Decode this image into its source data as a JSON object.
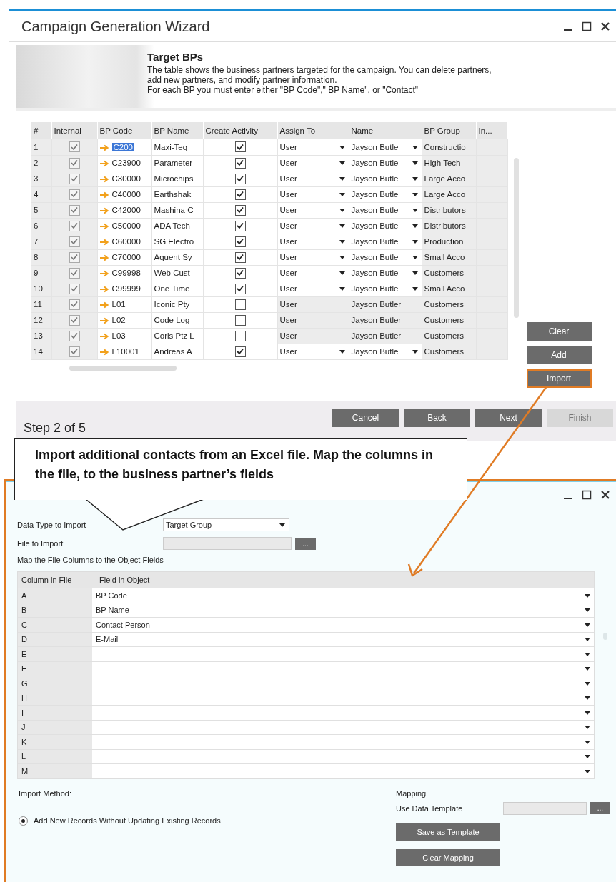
{
  "wizard": {
    "title": "Campaign Generation Wizard",
    "header": {
      "heading": "Target BPs",
      "lines": [
        "The table shows the business partners targeted for the campaign. You can delete partners,",
        "add new partners, and modify partner information.",
        "For each BP you must enter either \"BP Code\",\" BP Name\", or \"Contact\""
      ]
    },
    "table": {
      "columns": [
        "#",
        "Internal",
        "BP Code",
        "BP Name",
        "Create Activity",
        "Assign To",
        "Name",
        "BP Group",
        "In..."
      ],
      "rows": [
        {
          "num": "1",
          "internal": true,
          "bp_code": "C200",
          "code_selected": true,
          "bp_name": "Maxi-Teq",
          "create_activity": true,
          "assign_to": "User",
          "editable": true,
          "name": "Jayson Butle",
          "bp_group": "Constructio"
        },
        {
          "num": "2",
          "internal": true,
          "bp_code": "C23900",
          "code_selected": false,
          "bp_name": "Parameter",
          "create_activity": true,
          "assign_to": "User",
          "editable": true,
          "name": "Jayson Butle",
          "bp_group": "High Tech"
        },
        {
          "num": "3",
          "internal": true,
          "bp_code": "C30000",
          "code_selected": false,
          "bp_name": "Microchips",
          "create_activity": true,
          "assign_to": "User",
          "editable": true,
          "name": "Jayson Butle",
          "bp_group": "Large Acco"
        },
        {
          "num": "4",
          "internal": true,
          "bp_code": "C40000",
          "code_selected": false,
          "bp_name": "Earthshak",
          "create_activity": true,
          "assign_to": "User",
          "editable": true,
          "name": "Jayson Butle",
          "bp_group": "Large Acco"
        },
        {
          "num": "5",
          "internal": true,
          "bp_code": "C42000",
          "code_selected": false,
          "bp_name": "Mashina C",
          "create_activity": true,
          "assign_to": "User",
          "editable": true,
          "name": "Jayson Butle",
          "bp_group": "Distributors"
        },
        {
          "num": "6",
          "internal": true,
          "bp_code": "C50000",
          "code_selected": false,
          "bp_name": "ADA Tech",
          "create_activity": true,
          "assign_to": "User",
          "editable": true,
          "name": "Jayson Butle",
          "bp_group": "Distributors"
        },
        {
          "num": "7",
          "internal": true,
          "bp_code": "C60000",
          "code_selected": false,
          "bp_name": "SG Electro",
          "create_activity": true,
          "assign_to": "User",
          "editable": true,
          "name": "Jayson Butle",
          "bp_group": "Production"
        },
        {
          "num": "8",
          "internal": true,
          "bp_code": "C70000",
          "code_selected": false,
          "bp_name": "Aquent Sy",
          "create_activity": true,
          "assign_to": "User",
          "editable": true,
          "name": "Jayson Butle",
          "bp_group": "Small Acco"
        },
        {
          "num": "9",
          "internal": true,
          "bp_code": "C99998",
          "code_selected": false,
          "bp_name": "Web Cust",
          "create_activity": true,
          "assign_to": "User",
          "editable": true,
          "name": "Jayson Butle",
          "bp_group": "Customers"
        },
        {
          "num": "10",
          "internal": true,
          "bp_code": "C99999",
          "code_selected": false,
          "bp_name": "One Time",
          "create_activity": true,
          "assign_to": "User",
          "editable": true,
          "name": "Jayson Butle",
          "bp_group": "Small Acco"
        },
        {
          "num": "11",
          "internal": true,
          "bp_code": "L01",
          "code_selected": false,
          "bp_name": "Iconic Pty",
          "create_activity": false,
          "assign_to": "User",
          "editable": false,
          "name": "Jayson Butler",
          "bp_group": "Customers"
        },
        {
          "num": "12",
          "internal": true,
          "bp_code": "L02",
          "code_selected": false,
          "bp_name": "Code Log",
          "create_activity": false,
          "assign_to": "User",
          "editable": false,
          "name": "Jayson Butler",
          "bp_group": "Customers"
        },
        {
          "num": "13",
          "internal": true,
          "bp_code": "L03",
          "code_selected": false,
          "bp_name": "Coris Ptz L",
          "create_activity": false,
          "assign_to": "User",
          "editable": false,
          "name": "Jayson Butler",
          "bp_group": "Customers"
        },
        {
          "num": "14",
          "internal": true,
          "bp_code": "L10001",
          "code_selected": false,
          "bp_name": "Andreas A",
          "create_activity": true,
          "assign_to": "User",
          "editable": true,
          "name": "Jayson Butle",
          "bp_group": "Customers"
        }
      ]
    },
    "side_buttons": [
      {
        "label": "Clear",
        "highlighted": false
      },
      {
        "label": "Add",
        "highlighted": false
      },
      {
        "label": "Import",
        "highlighted": true
      }
    ],
    "step": "Step 2 of 5",
    "nav_buttons": [
      {
        "label": "Cancel",
        "disabled": false
      },
      {
        "label": "Back",
        "disabled": false
      },
      {
        "label": "Next",
        "disabled": false
      },
      {
        "label": "Finish",
        "disabled": true
      }
    ]
  },
  "callout": {
    "text": "Import additional contacts from an Excel file. Map the columns in the file, to the business partner’s fields"
  },
  "import_dialog": {
    "data_type": {
      "label": "Data Type to Import",
      "value": "Target Group"
    },
    "file": {
      "label": "File to Import",
      "button": "..."
    },
    "map_caption": "Map the File Columns to the Object Fields",
    "table": {
      "columns": [
        "Column in File",
        "Field in Object"
      ],
      "rows": [
        {
          "column": "A",
          "field": "BP Code"
        },
        {
          "column": "B",
          "field": "BP Name"
        },
        {
          "column": "C",
          "field": "Contact Person"
        },
        {
          "column": "D",
          "field": "E-Mail"
        },
        {
          "column": "E"
        },
        {
          "column": "F"
        },
        {
          "column": "G"
        },
        {
          "column": "H"
        },
        {
          "column": "I"
        },
        {
          "column": "J"
        },
        {
          "column": "K"
        },
        {
          "column": "L"
        },
        {
          "column": "M"
        }
      ]
    },
    "import_method": {
      "label": "Import Method:",
      "options": [
        {
          "label": "Add New Records Without Updating Existing Records",
          "selected": true
        }
      ]
    },
    "mapping": {
      "heading": "Mapping",
      "template_label": "Use Data Template",
      "template_button": "...",
      "buttons": [
        "Save as Template",
        "Clear Mapping"
      ]
    }
  }
}
